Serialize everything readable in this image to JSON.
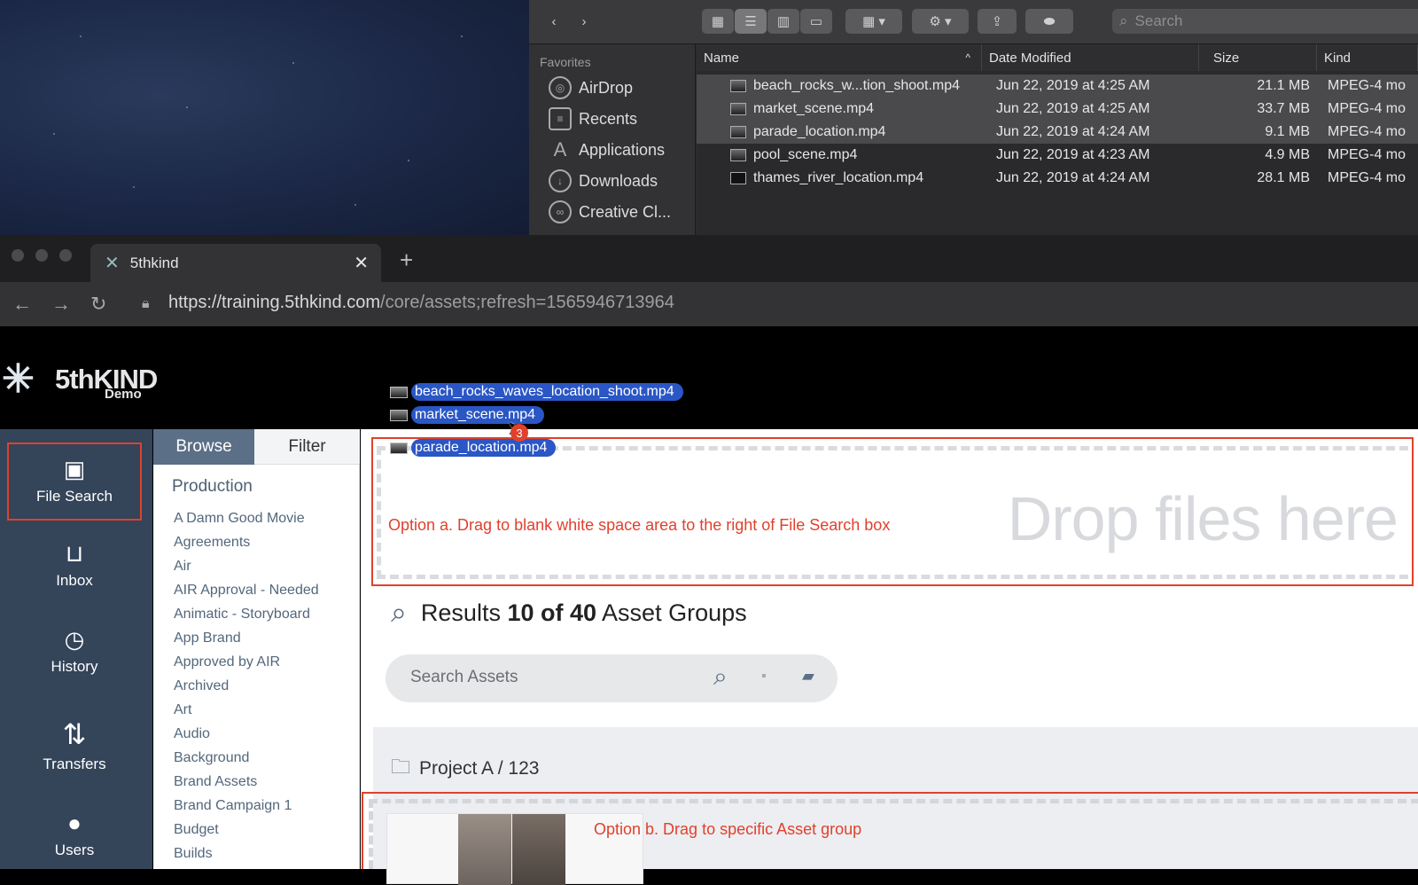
{
  "finder": {
    "search_placeholder": "Search",
    "sidebar_heading": "Favorites",
    "sidebar_items": [
      {
        "label": "AirDrop",
        "icon": "airdrop-icon"
      },
      {
        "label": "Recents",
        "icon": "recents-icon"
      },
      {
        "label": "Applications",
        "icon": "applications-icon"
      },
      {
        "label": "Downloads",
        "icon": "downloads-icon"
      },
      {
        "label": "Creative Cl...",
        "icon": "creative-cloud-icon"
      }
    ],
    "columns": {
      "name": "Name",
      "date": "Date Modified",
      "size": "Size",
      "kind": "Kind"
    },
    "files": [
      {
        "name": "beach_rocks_w...tion_shoot.mp4",
        "date": "Jun 22, 2019 at 4:25 AM",
        "size": "21.1 MB",
        "kind": "MPEG-4 mo",
        "selected": true
      },
      {
        "name": "market_scene.mp4",
        "date": "Jun 22, 2019 at 4:25 AM",
        "size": "33.7 MB",
        "kind": "MPEG-4 mo",
        "selected": true
      },
      {
        "name": "parade_location.mp4",
        "date": "Jun 22, 2019 at 4:24 AM",
        "size": "9.1 MB",
        "kind": "MPEG-4 mo",
        "selected": true
      },
      {
        "name": "pool_scene.mp4",
        "date": "Jun 22, 2019 at 4:23 AM",
        "size": "4.9 MB",
        "kind": "MPEG-4 mo",
        "selected": false
      },
      {
        "name": "thames_river_location.mp4",
        "date": "Jun 22, 2019 at 4:24 AM",
        "size": "28.1 MB",
        "kind": "MPEG-4 mo",
        "selected": false
      }
    ]
  },
  "browser": {
    "tab_title": "5thkind",
    "url_host": "https://training.5thkind.com",
    "url_path": "/core/assets;refresh=1565946713964"
  },
  "app": {
    "logo": "5thKIND",
    "logo_sub": "Demo",
    "dragging_files": [
      "beach_rocks_waves_location_shoot.mp4",
      "market_scene.mp4",
      "parade_location.mp4"
    ],
    "drag_count": "3",
    "nav": [
      {
        "label": "File Search",
        "icon": "image-icon",
        "active": true
      },
      {
        "label": "Inbox",
        "icon": "inbox-icon",
        "active": false
      },
      {
        "label": "History",
        "icon": "clock-icon",
        "active": false
      },
      {
        "label": "Transfers",
        "icon": "transfer-icon",
        "active": false
      },
      {
        "label": "Users",
        "icon": "user-icon",
        "active": false
      }
    ],
    "browse_tab": "Browse",
    "filter_tab": "Filter",
    "production_heading": "Production",
    "browse_items": [
      "A Damn Good Movie",
      "Agreements",
      "Air",
      "AIR Approval - Needed",
      "Animatic - Storyboard",
      "App Brand",
      "Approved by AIR",
      "Archived",
      "Art",
      "Audio",
      "Background",
      "Brand Assets",
      "Brand Campaign 1",
      "Budget",
      "Builds"
    ],
    "drop_text": "Drop files here",
    "option_a": "Option a. Drag to blank white space area to the right of File Search box",
    "results_prefix": "Results",
    "results_count": "10 of 40",
    "results_suffix": "Asset Groups",
    "search_placeholder": "Search Assets",
    "group_title": "Project A / 123",
    "option_b": "Option b. Drag to specific Asset group"
  },
  "colors": {
    "accent_red": "#e0412d",
    "nav_bg": "#344459",
    "browse_active": "#5b6f86",
    "drag_pill": "#2a56c6"
  }
}
